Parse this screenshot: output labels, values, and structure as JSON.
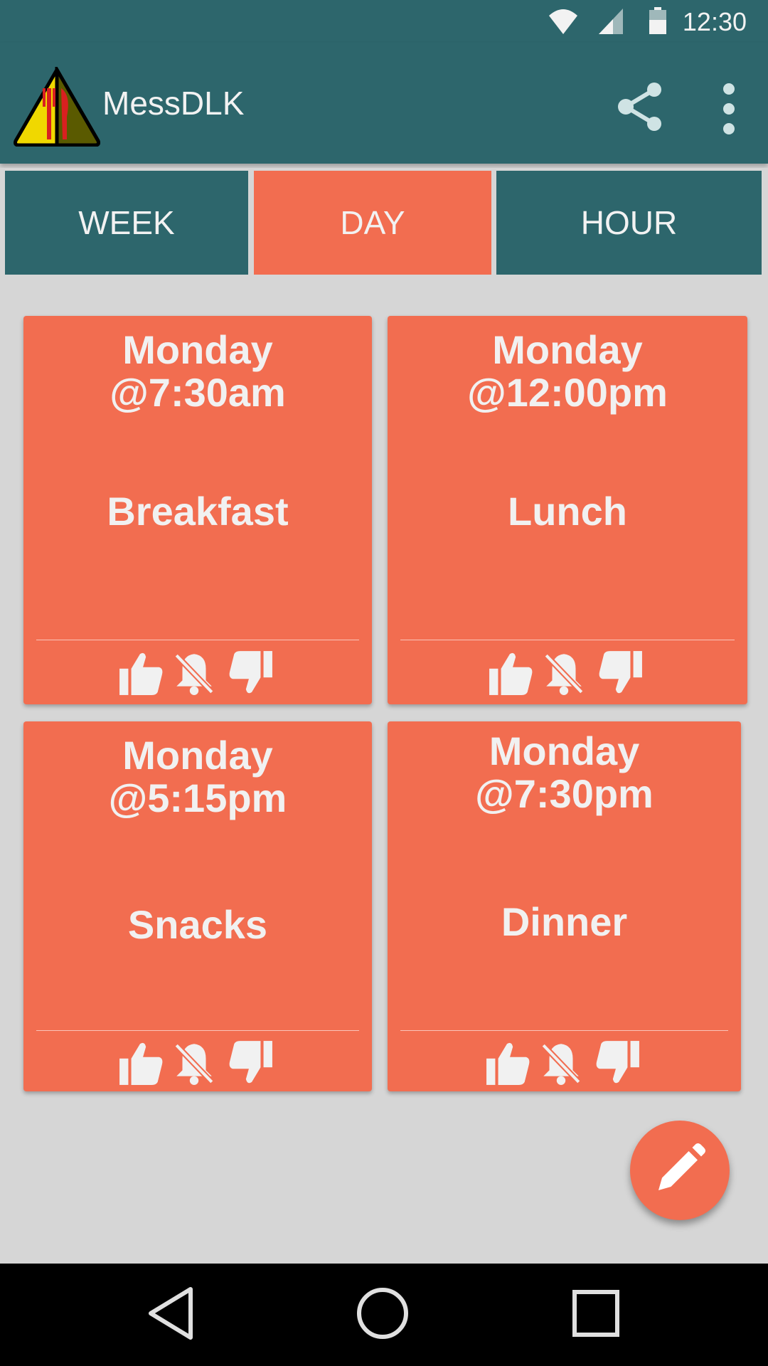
{
  "status_bar": {
    "time": "12:30"
  },
  "app_bar": {
    "title": "MessDLK",
    "share_icon": "share-icon",
    "overflow_icon": "more-vert-icon"
  },
  "tabs": [
    {
      "label": "WEEK"
    },
    {
      "label": "DAY"
    },
    {
      "label": "HOUR"
    }
  ],
  "meals": [
    {
      "day": "Monday",
      "time": "@7:30am",
      "name": "Breakfast"
    },
    {
      "day": "Monday",
      "time": "@12:00pm",
      "name": "Lunch"
    },
    {
      "day": "Monday",
      "time": "@5:15pm",
      "name": "Snacks"
    },
    {
      "day": "Monday",
      "time": "@7:30pm",
      "name": "Dinner"
    }
  ],
  "colors": {
    "primary": "#2d666c",
    "accent": "#f26d50",
    "background": "#d6d6d6"
  }
}
